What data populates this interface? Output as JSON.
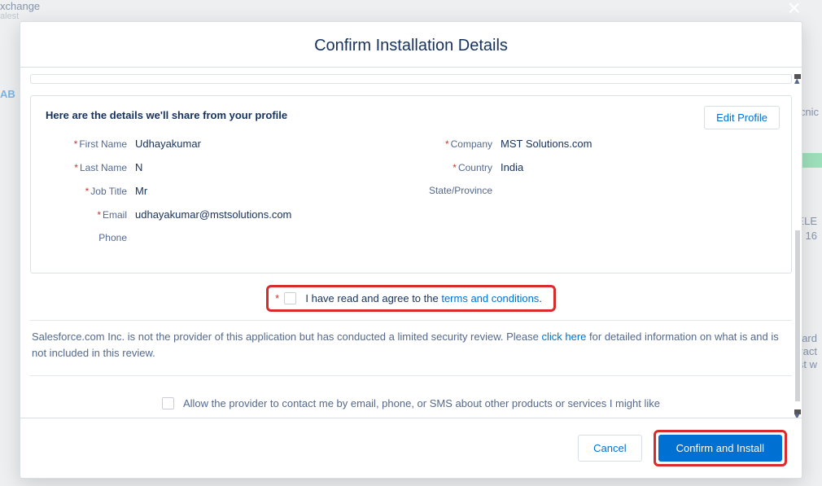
{
  "bg": {
    "exchange": "xchange",
    "abs": "AB",
    "salest": "alest",
    "cnic": "cnic",
    "ele": "ELE",
    "yr": "16",
    "ard": "ard",
    "ract": "ract",
    "stw": "st w"
  },
  "modal": {
    "title": "Confirm Installation Details"
  },
  "details": {
    "heading": "Here are the details we'll share from your profile",
    "edit_profile": "Edit Profile",
    "left": [
      {
        "label": "First Name",
        "value": "Udhayakumar",
        "required": true
      },
      {
        "label": "Last Name",
        "value": "N",
        "required": true
      },
      {
        "label": "Job Title",
        "value": "Mr",
        "required": true
      },
      {
        "label": "Email",
        "value": "udhayakumar@mstsolutions.com",
        "required": true
      },
      {
        "label": "Phone",
        "value": "",
        "required": false
      }
    ],
    "right": [
      {
        "label": "Company",
        "value": "MST Solutions.com",
        "required": true
      },
      {
        "label": "Country",
        "value": "India",
        "required": true
      },
      {
        "label": "State/Province",
        "value": "",
        "required": false
      }
    ]
  },
  "terms": {
    "prefix": "I have read and agree to the ",
    "link": "terms and conditions",
    "suffix": "."
  },
  "disclaimer": {
    "before": "Salesforce.com Inc. is not the provider of this application but has conducted a limited security review. Please ",
    "link": "click here",
    "after": " for detailed information on what is and is not included in this review."
  },
  "allow": {
    "text": "Allow the provider to contact me by email, phone, or SMS about other products or services I might like"
  },
  "footer": {
    "cancel": "Cancel",
    "confirm": "Confirm and Install"
  }
}
